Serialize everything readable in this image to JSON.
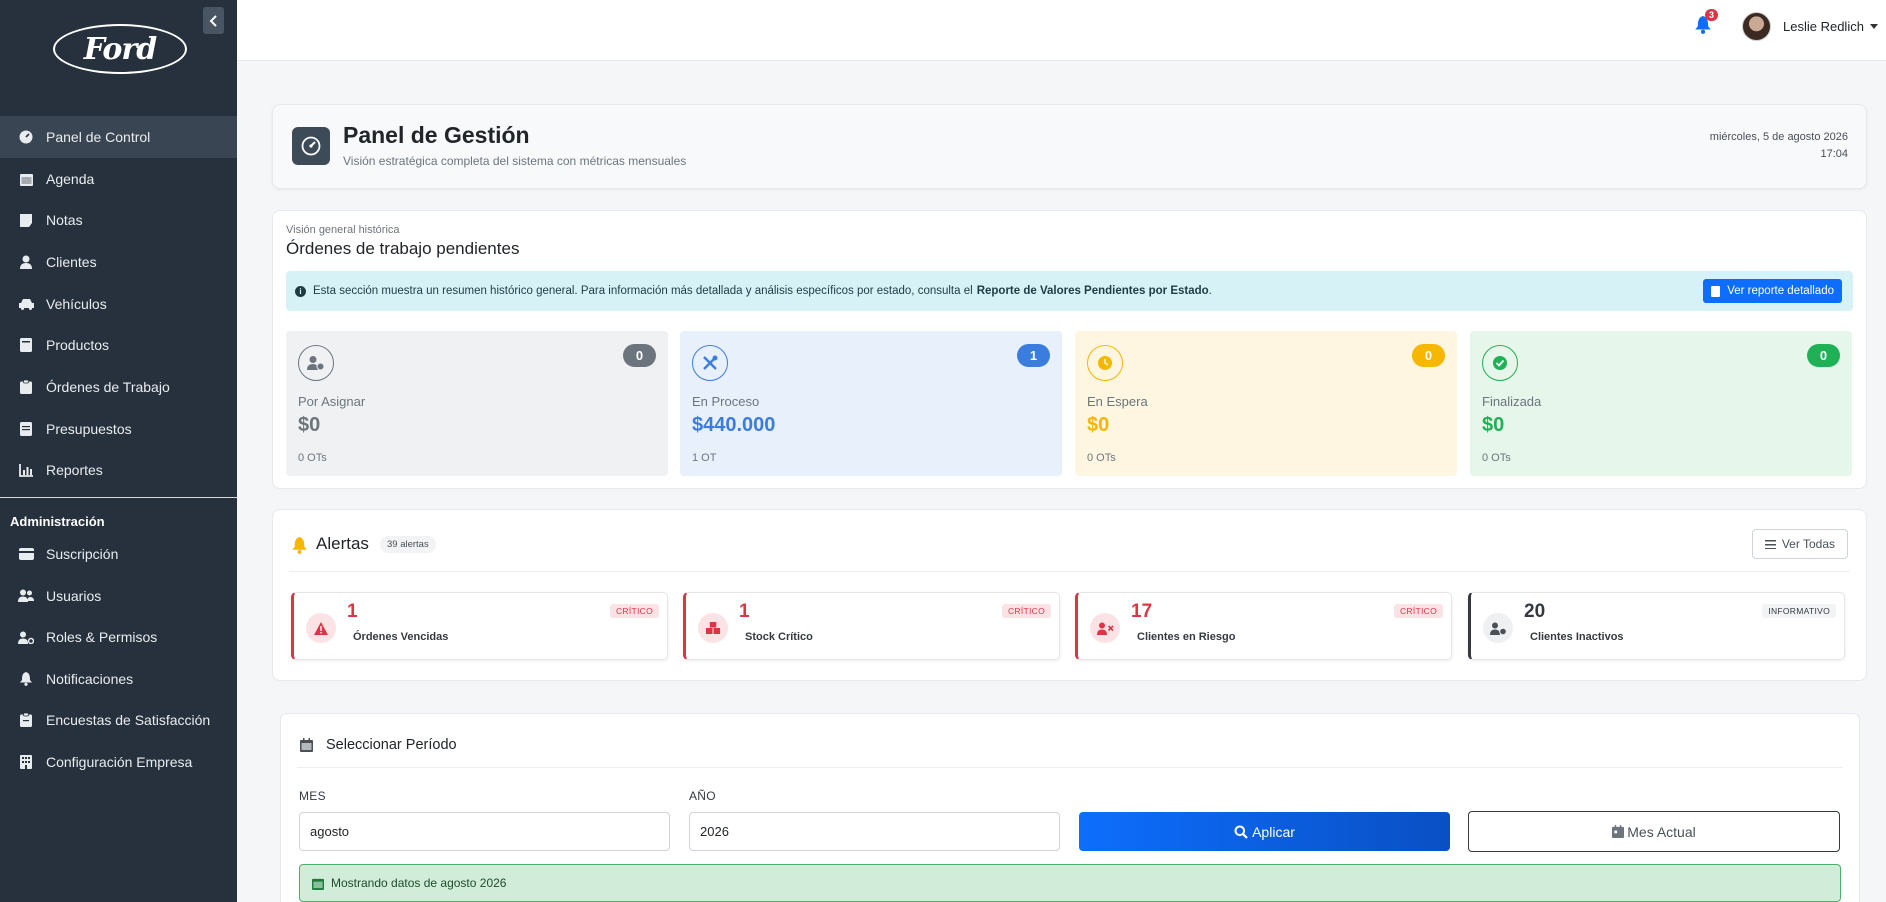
{
  "brand": {
    "logo_text": "Ford"
  },
  "sidebar": {
    "items": [
      {
        "label": "Panel de Control",
        "icon": "gauge-icon",
        "active": true
      },
      {
        "label": "Agenda",
        "icon": "calendar-icon"
      },
      {
        "label": "Notas",
        "icon": "note-icon"
      },
      {
        "label": "Clientes",
        "icon": "user-icon"
      },
      {
        "label": "Vehículos",
        "icon": "car-icon"
      },
      {
        "label": "Productos",
        "icon": "box-icon"
      },
      {
        "label": "Órdenes de Trabajo",
        "icon": "clipboard-icon"
      },
      {
        "label": "Presupuestos",
        "icon": "file-invoice-icon"
      },
      {
        "label": "Reportes",
        "icon": "chart-icon"
      }
    ],
    "admin_section": "Administración",
    "admin_items": [
      {
        "label": "Suscripción",
        "icon": "wallet-icon"
      },
      {
        "label": "Usuarios",
        "icon": "users-icon"
      },
      {
        "label": "Roles & Permisos",
        "icon": "user-gear-icon"
      },
      {
        "label": "Notificaciones",
        "icon": "bell-icon"
      },
      {
        "label": "Encuestas de Satisfacción",
        "icon": "survey-icon"
      },
      {
        "label": "Configuración Empresa",
        "icon": "building-icon"
      }
    ]
  },
  "topbar": {
    "notif_count": "3",
    "user_name": "Leslie Redlich"
  },
  "header": {
    "title": "Panel de Gestión",
    "subtitle": "Visión estratégica completa del sistema con métricas mensuales",
    "date": "miércoles, 5 de agosto 2026",
    "time": "17:04"
  },
  "pending": {
    "kicker": "Visión general histórica",
    "title": "Órdenes de trabajo pendientes",
    "info_text": "Esta sección muestra un resumen histórico general. Para información más detallada y análisis específicos por estado, consulta el",
    "info_bold": "Reporte de Valores Pendientes por Estado",
    "info_end": ".",
    "report_button": "Ver reporte detallado",
    "stats": [
      {
        "label": "Por Asignar",
        "value": "$0",
        "sub": "0 OTs",
        "badge": "0",
        "color": "#6c757d",
        "bg": "#f0f1f2"
      },
      {
        "label": "En Proceso",
        "value": "$440.000",
        "sub": "1 OT",
        "badge": "1",
        "color": "#3b7ddd",
        "bg": "#e8f0fb"
      },
      {
        "label": "En Espera",
        "value": "$0",
        "sub": "0 OTs",
        "badge": "0",
        "color": "#f5b700",
        "bg": "#fff6e2"
      },
      {
        "label": "Finalizada",
        "value": "$0",
        "sub": "0 OTs",
        "badge": "0",
        "color": "#1fb155",
        "bg": "#e6f6ea"
      }
    ]
  },
  "alerts": {
    "title": "Alertas",
    "count": "39 alertas",
    "view_all": "Ver Todas",
    "items": [
      {
        "num": "1",
        "label": "Órdenes Vencidas",
        "tag": "CRÍTICO",
        "color": "#dc3545",
        "icon": "warning-icon"
      },
      {
        "num": "1",
        "label": "Stock Crítico",
        "icon": "boxes-icon",
        "tag": "CRÍTICO",
        "color": "#dc3545"
      },
      {
        "num": "17",
        "label": "Clientes en Riesgo",
        "icon": "user-x-icon",
        "tag": "CRÍTICO",
        "color": "#dc3545"
      },
      {
        "num": "20",
        "label": "Clientes Inactivos",
        "icon": "user-clock-icon",
        "tag": "INFORMATIVO",
        "color": "#343a40"
      }
    ]
  },
  "period": {
    "title": "Seleccionar Período",
    "month_label": "MES",
    "month_value": "agosto",
    "year_label": "AÑO",
    "year_value": "2026",
    "apply": "Aplicar",
    "current": "Mes Actual",
    "showing": "Mostrando datos de agosto 2026"
  }
}
